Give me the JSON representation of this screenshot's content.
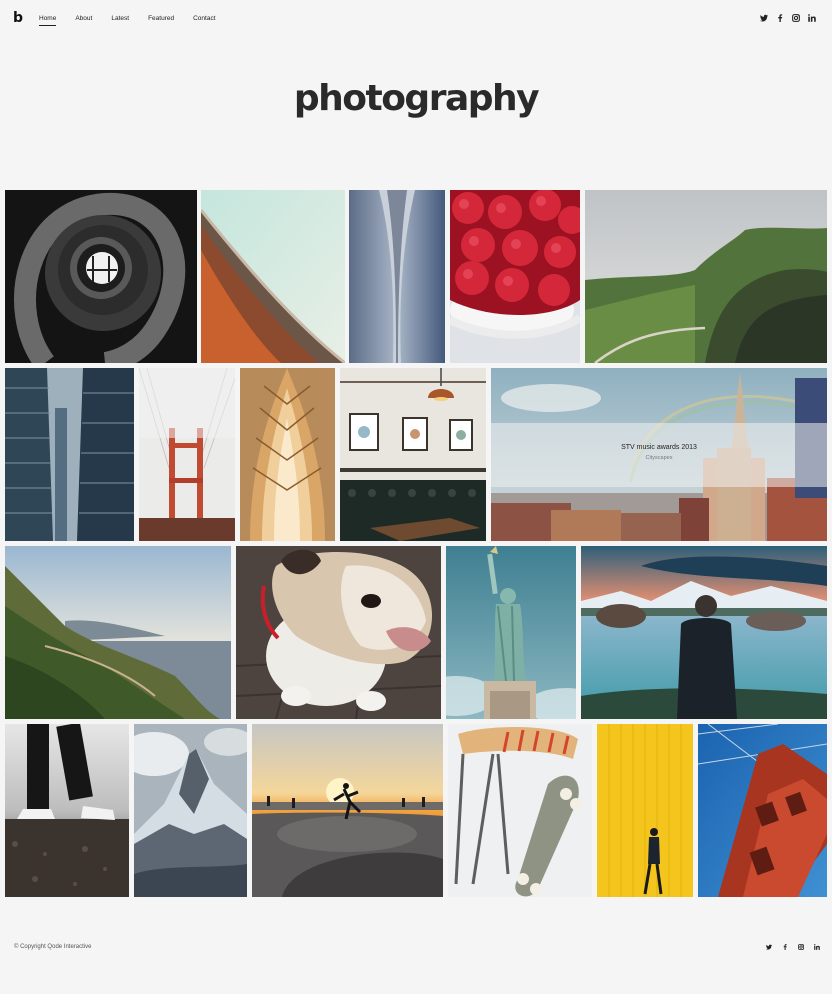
{
  "header": {
    "logo": "b",
    "nav": [
      {
        "label": "Home",
        "active": true
      },
      {
        "label": "About",
        "active": false
      },
      {
        "label": "Latest",
        "active": false
      },
      {
        "label": "Featured",
        "active": false
      },
      {
        "label": "Contact",
        "active": false
      }
    ],
    "social": [
      "twitter-icon",
      "facebook-icon",
      "instagram-icon",
      "linkedin-icon"
    ]
  },
  "page": {
    "title": "photography"
  },
  "portfolio": {
    "items": [
      {
        "subject": "spiral-staircase"
      },
      {
        "subject": "curved-architecture"
      },
      {
        "subject": "skyscraper-facade"
      },
      {
        "subject": "raspberries-bowl"
      },
      {
        "subject": "green-hills"
      },
      {
        "subject": "city-buildings"
      },
      {
        "subject": "golden-gate-fog"
      },
      {
        "subject": "wooden-arches"
      },
      {
        "subject": "cafe-interior"
      },
      {
        "subject": "empire-state-rainbow",
        "hover_title": "STV music awards 2013",
        "hover_category": "Cityscapes"
      },
      {
        "subject": "coastal-cliffs"
      },
      {
        "subject": "bulldog"
      },
      {
        "subject": "statue-of-liberty"
      },
      {
        "subject": "lake-hiker"
      },
      {
        "subject": "sneakers-feet"
      },
      {
        "subject": "matterhorn"
      },
      {
        "subject": "skatepark-sunset"
      },
      {
        "subject": "skateboard-studio"
      },
      {
        "subject": "yellow-wall-walker"
      },
      {
        "subject": "golden-gate-tower"
      }
    ]
  },
  "footer": {
    "copyright": "© Copyright Qode Interactive",
    "social": [
      "twitter-icon",
      "facebook-icon",
      "instagram-icon",
      "linkedin-icon"
    ]
  }
}
